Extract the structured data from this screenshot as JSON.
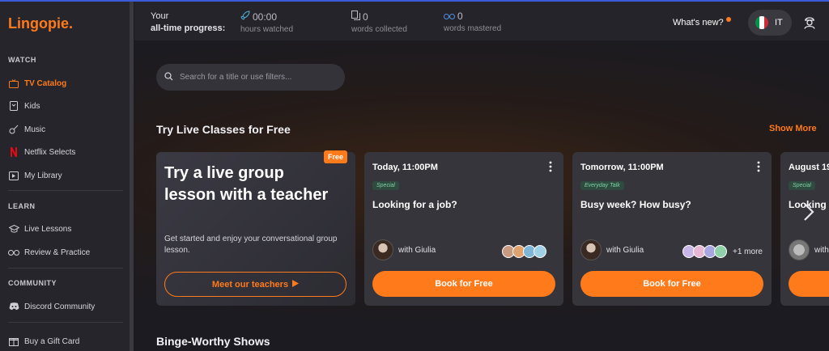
{
  "brand": {
    "logo": "Lingopie.",
    "accent": "#ff7a1a"
  },
  "sidebar": {
    "sections": [
      {
        "title": "WATCH",
        "items": [
          {
            "label": "TV Catalog",
            "icon": "tv-icon",
            "active": true
          },
          {
            "label": "Kids",
            "icon": "kids-icon"
          },
          {
            "label": "Music",
            "icon": "guitar-icon"
          },
          {
            "label": "Netflix Selects",
            "icon": "netflix-icon"
          },
          {
            "label": "My Library",
            "icon": "library-icon"
          }
        ]
      },
      {
        "title": "LEARN",
        "items": [
          {
            "label": "Live Lessons",
            "icon": "graduation-cap-icon"
          },
          {
            "label": "Review & Practice",
            "icon": "glasses-icon"
          }
        ]
      },
      {
        "title": "COMMUNITY",
        "items": [
          {
            "label": "Discord Community",
            "icon": "discord-icon"
          }
        ]
      }
    ],
    "gift": {
      "label": "Buy a Gift Card",
      "icon": "gift-icon"
    }
  },
  "topbar": {
    "progress_label_1": "Your",
    "progress_label_2": "all-time progress:",
    "stats": [
      {
        "value": "00:00",
        "label": "hours watched",
        "icon": "rocket-icon"
      },
      {
        "value": "0",
        "label": "words collected",
        "icon": "cards-icon"
      },
      {
        "value": "0",
        "label": "words mastered",
        "icon": "glasses-icon"
      }
    ],
    "whats_new": "What's new?",
    "language": "IT"
  },
  "main": {
    "search_placeholder": "Search for a title or use filters...",
    "live_classes": {
      "title": "Try Live Classes for Free",
      "show_more": "Show More",
      "promo": {
        "badge": "Free",
        "title": "Try a live group lesson with a teacher",
        "description": "Get started and enjoy your conversational group lesson.",
        "button": "Meet our teachers"
      },
      "classes": [
        {
          "time": "Today, 11:00PM",
          "tag": "Special",
          "title": "Looking for a job?",
          "teacher": "with Giulia",
          "more": "",
          "button": "Book for Free"
        },
        {
          "time": "Tomorrow, 11:00PM",
          "tag": "Everyday Talk",
          "title": "Busy week? How busy?",
          "teacher": "with Giulia",
          "more": "+1 more",
          "button": "Book for Free"
        },
        {
          "time": "August 19",
          "tag": "Special",
          "title": "Looking",
          "teacher": "with",
          "more": "",
          "button": ""
        }
      ]
    },
    "binge": {
      "title": "Binge-Worthy Shows"
    }
  }
}
